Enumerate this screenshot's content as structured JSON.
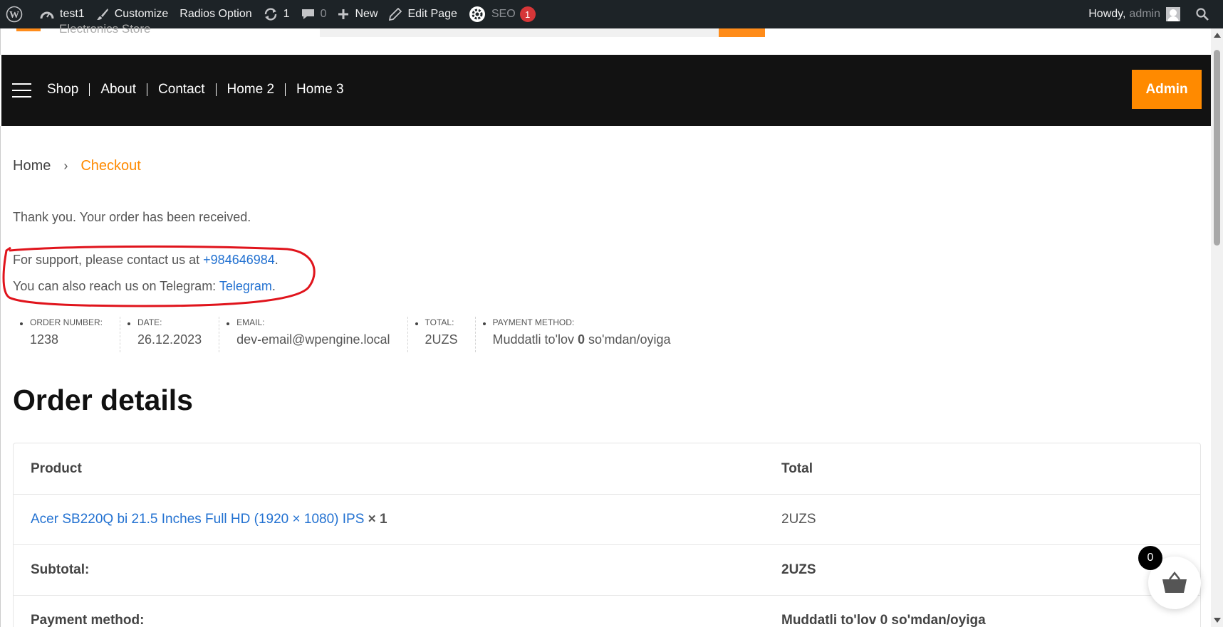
{
  "adminbar": {
    "site_name": "test1",
    "customize": "Customize",
    "radios_option": "Radios Option",
    "updates_count": "1",
    "comments_count": "0",
    "new": "New",
    "edit_page": "Edit Page",
    "seo": "SEO",
    "seo_badge": "1",
    "howdy": "Howdy,",
    "user": "admin"
  },
  "header": {
    "store_tagline": "Electronics Store"
  },
  "nav": {
    "items": [
      "Shop",
      "About",
      "Contact",
      "Home 2",
      "Home 3"
    ],
    "admin_button": "Admin"
  },
  "breadcrumb": {
    "home": "Home",
    "separator": "›",
    "current": "Checkout"
  },
  "thanks": "Thank you. Your order has been received.",
  "support": {
    "phone_prefix": "For support, please contact us at ",
    "phone": "+984646984",
    "telegram_prefix": "You can also reach us on Telegram: ",
    "telegram": "Telegram"
  },
  "order_meta": [
    {
      "label": "Order number:",
      "value": "1238"
    },
    {
      "label": "Date:",
      "value": "26.12.2023"
    },
    {
      "label": "Email:",
      "value": "dev-email@wpengine.local"
    },
    {
      "label": "Total:",
      "value": "2UZS"
    },
    {
      "label": "Payment method:",
      "value_prefix": "Muddatli to'lov ",
      "value_bold": "0",
      "value_suffix": " so'mdan/oyiga"
    }
  ],
  "order_details": {
    "title": "Order details",
    "header_product": "Product",
    "header_total": "Total",
    "product_name": "Acer SB220Q bi 21.5 Inches Full HD (1920 × 1080) IPS",
    "product_qty": " × 1",
    "product_total": "2UZS",
    "subtotal_label": "Subtotal:",
    "subtotal_value": "2UZS",
    "payment_label": "Payment method:",
    "payment_prefix": "Muddatli to'lov ",
    "payment_bold": "0",
    "payment_suffix": " so'mdan/oyiga"
  },
  "cart": {
    "count": "0"
  },
  "colors": {
    "accent": "#ff8a00",
    "link": "#2271d1",
    "adminbar": "#1d2327",
    "navbar": "#121212",
    "annotation": "#e0141c"
  }
}
